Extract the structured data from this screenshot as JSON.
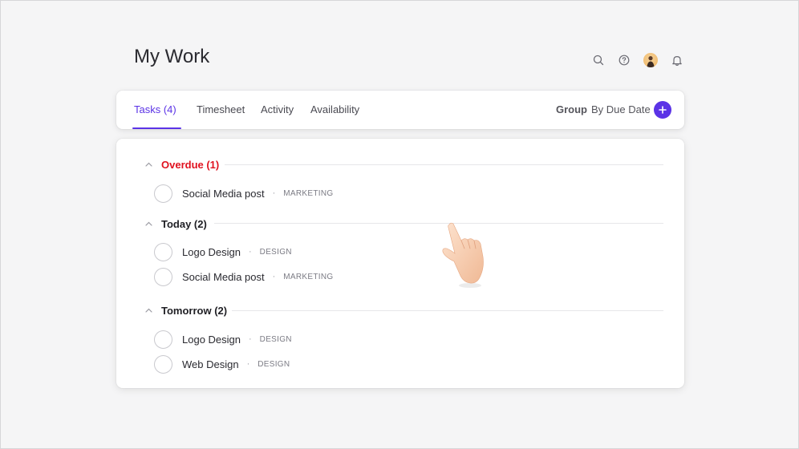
{
  "header": {
    "title": "My Work"
  },
  "tabs": [
    {
      "label": "Tasks (4)",
      "active": true
    },
    {
      "label": "Timesheet",
      "active": false
    },
    {
      "label": "Activity",
      "active": false
    },
    {
      "label": "Availability",
      "active": false
    }
  ],
  "group": {
    "label": "Group",
    "value": "By Due Date",
    "add_icon": "plus-icon"
  },
  "top_icons": [
    "search-icon",
    "help-icon",
    "avatar",
    "bell-icon"
  ],
  "colors": {
    "accent": "#5b33e6",
    "overdue": "#e0121f"
  },
  "sections": [
    {
      "title": "Overdue (1)",
      "tasks": [
        {
          "title": "Social Media post",
          "tag": "MARKETING"
        }
      ]
    },
    {
      "title": "Today (2)",
      "tasks": [
        {
          "title": "Logo Design",
          "tag": "DESIGN"
        },
        {
          "title": "Social Media post",
          "tag": "MARKETING"
        }
      ]
    },
    {
      "title": "Tomorrow (2)",
      "tasks": [
        {
          "title": "Logo Design",
          "tag": "DESIGN"
        },
        {
          "title": "Web Design",
          "tag": "DESIGN"
        }
      ]
    }
  ],
  "separator": "·"
}
